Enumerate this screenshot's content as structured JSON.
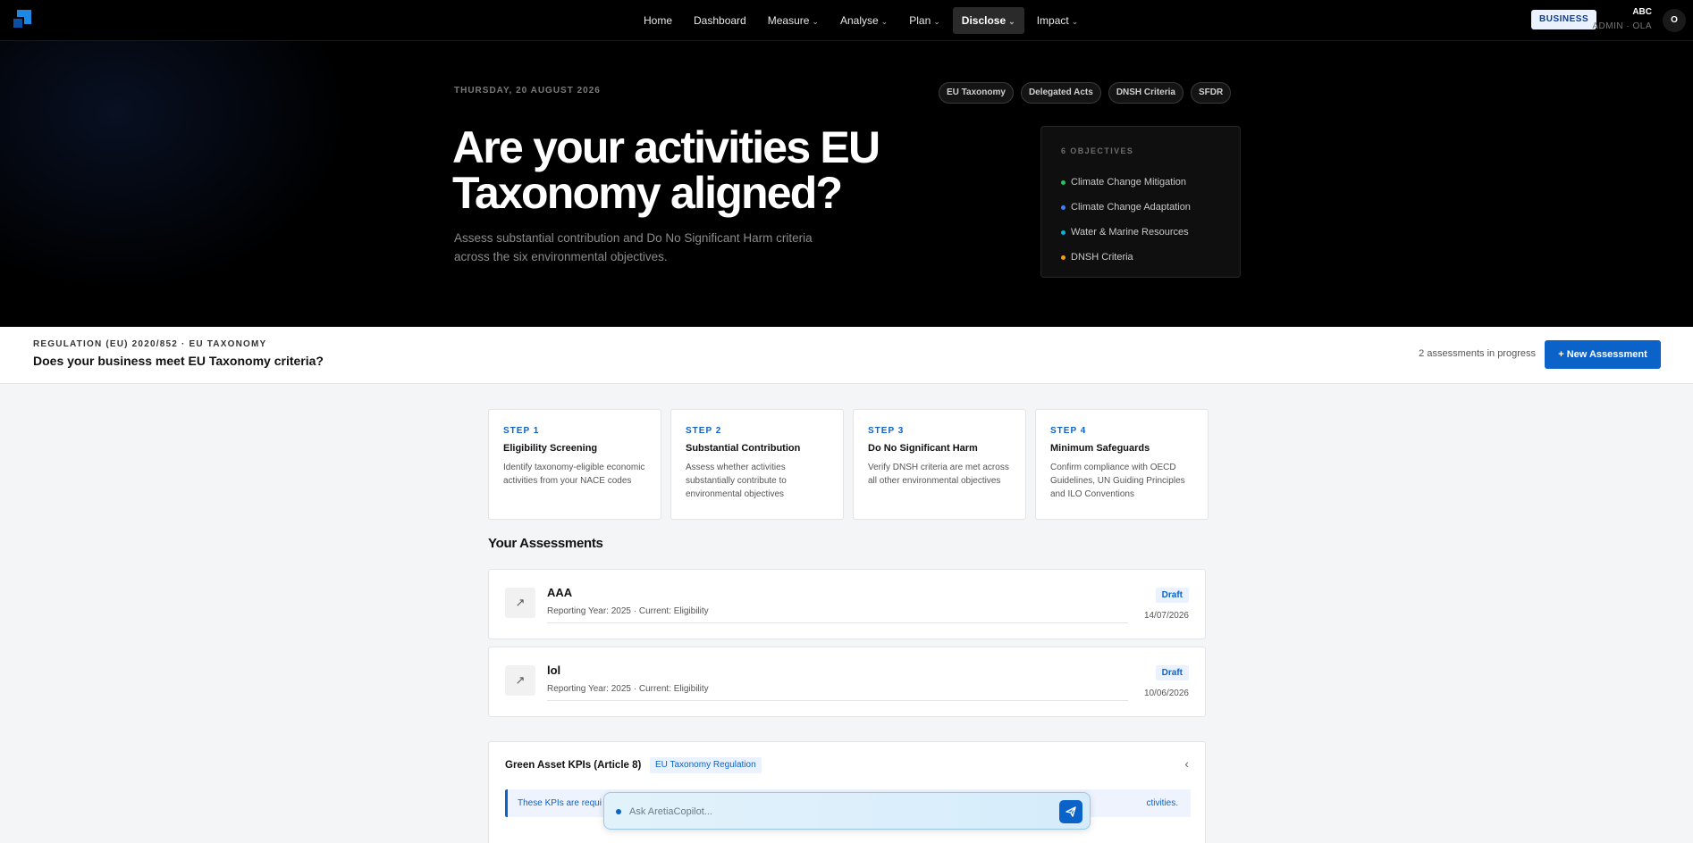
{
  "nav": {
    "items": [
      {
        "label": "Home",
        "has_menu": false
      },
      {
        "label": "Dashboard",
        "has_menu": false
      },
      {
        "label": "Measure",
        "has_menu": true
      },
      {
        "label": "Analyse",
        "has_menu": true
      },
      {
        "label": "Plan",
        "has_menu": true
      },
      {
        "label": "Disclose",
        "has_menu": true,
        "active": true
      },
      {
        "label": "Impact",
        "has_menu": true
      }
    ],
    "business_badge": "BUSINESS",
    "user_name": "ABC",
    "user_role": "ADMIN · OLA",
    "avatar_initial": "O"
  },
  "hero": {
    "date": "THURSDAY, 20 AUGUST 2026",
    "tags": [
      "EU Taxonomy",
      "Delegated Acts",
      "DNSH Criteria",
      "SFDR"
    ],
    "title": "Are your activities EU Taxonomy aligned?",
    "subtitle": "Assess substantial contribution and Do No Significant Harm criteria across the six environmental objectives.",
    "objectives_title": "6 OBJECTIVES",
    "objectives": [
      {
        "label": "Climate Change Mitigation",
        "color": "#22c55e"
      },
      {
        "label": "Climate Change Adaptation",
        "color": "#3b82f6"
      },
      {
        "label": "Water & Marine Resources",
        "color": "#06b6d4"
      },
      {
        "label": "DNSH Criteria",
        "color": "#f59e0b"
      }
    ]
  },
  "regulation": {
    "kicker": "REGULATION (EU) 2020/852 · EU TAXONOMY",
    "title": "Does your business meet EU Taxonomy criteria?",
    "count_text": "2 assessments in progress",
    "new_button": "+ New Assessment"
  },
  "steps": [
    {
      "kicker": "STEP 1",
      "title": "Eligibility Screening",
      "desc": "Identify taxonomy-eligible economic activities from your NACE codes"
    },
    {
      "kicker": "STEP 2",
      "title": "Substantial Contribution",
      "desc": "Assess whether activities substantially contribute to environmental objectives"
    },
    {
      "kicker": "STEP 3",
      "title": "Do No Significant Harm",
      "desc": "Verify DNSH criteria are met across all other environmental objectives"
    },
    {
      "kicker": "STEP 4",
      "title": "Minimum Safeguards",
      "desc": "Confirm compliance with OECD Guidelines, UN Guiding Principles and ILO Conventions"
    }
  ],
  "assessments_title": "Your Assessments",
  "assessments": [
    {
      "name": "AAA",
      "meta": "Reporting Year: 2025 · Current: Eligibility",
      "status": "Draft",
      "date": "14/07/2026"
    },
    {
      "name": "lol",
      "meta": "Reporting Year: 2025 · Current: Eligibility",
      "status": "Draft",
      "date": "10/06/2026"
    }
  ],
  "green_asset": {
    "title": "Green Asset KPIs (Article 8)",
    "tag": "EU Taxonomy Regulation",
    "note_start": "These KPIs are requi",
    "note_end": "ctivities."
  },
  "copilot": {
    "placeholder": "Ask AretiaCopilot..."
  },
  "colors": {
    "accent": "#0b63c9",
    "nav_bg": "#000000",
    "page_bg": "#f4f5f7"
  }
}
